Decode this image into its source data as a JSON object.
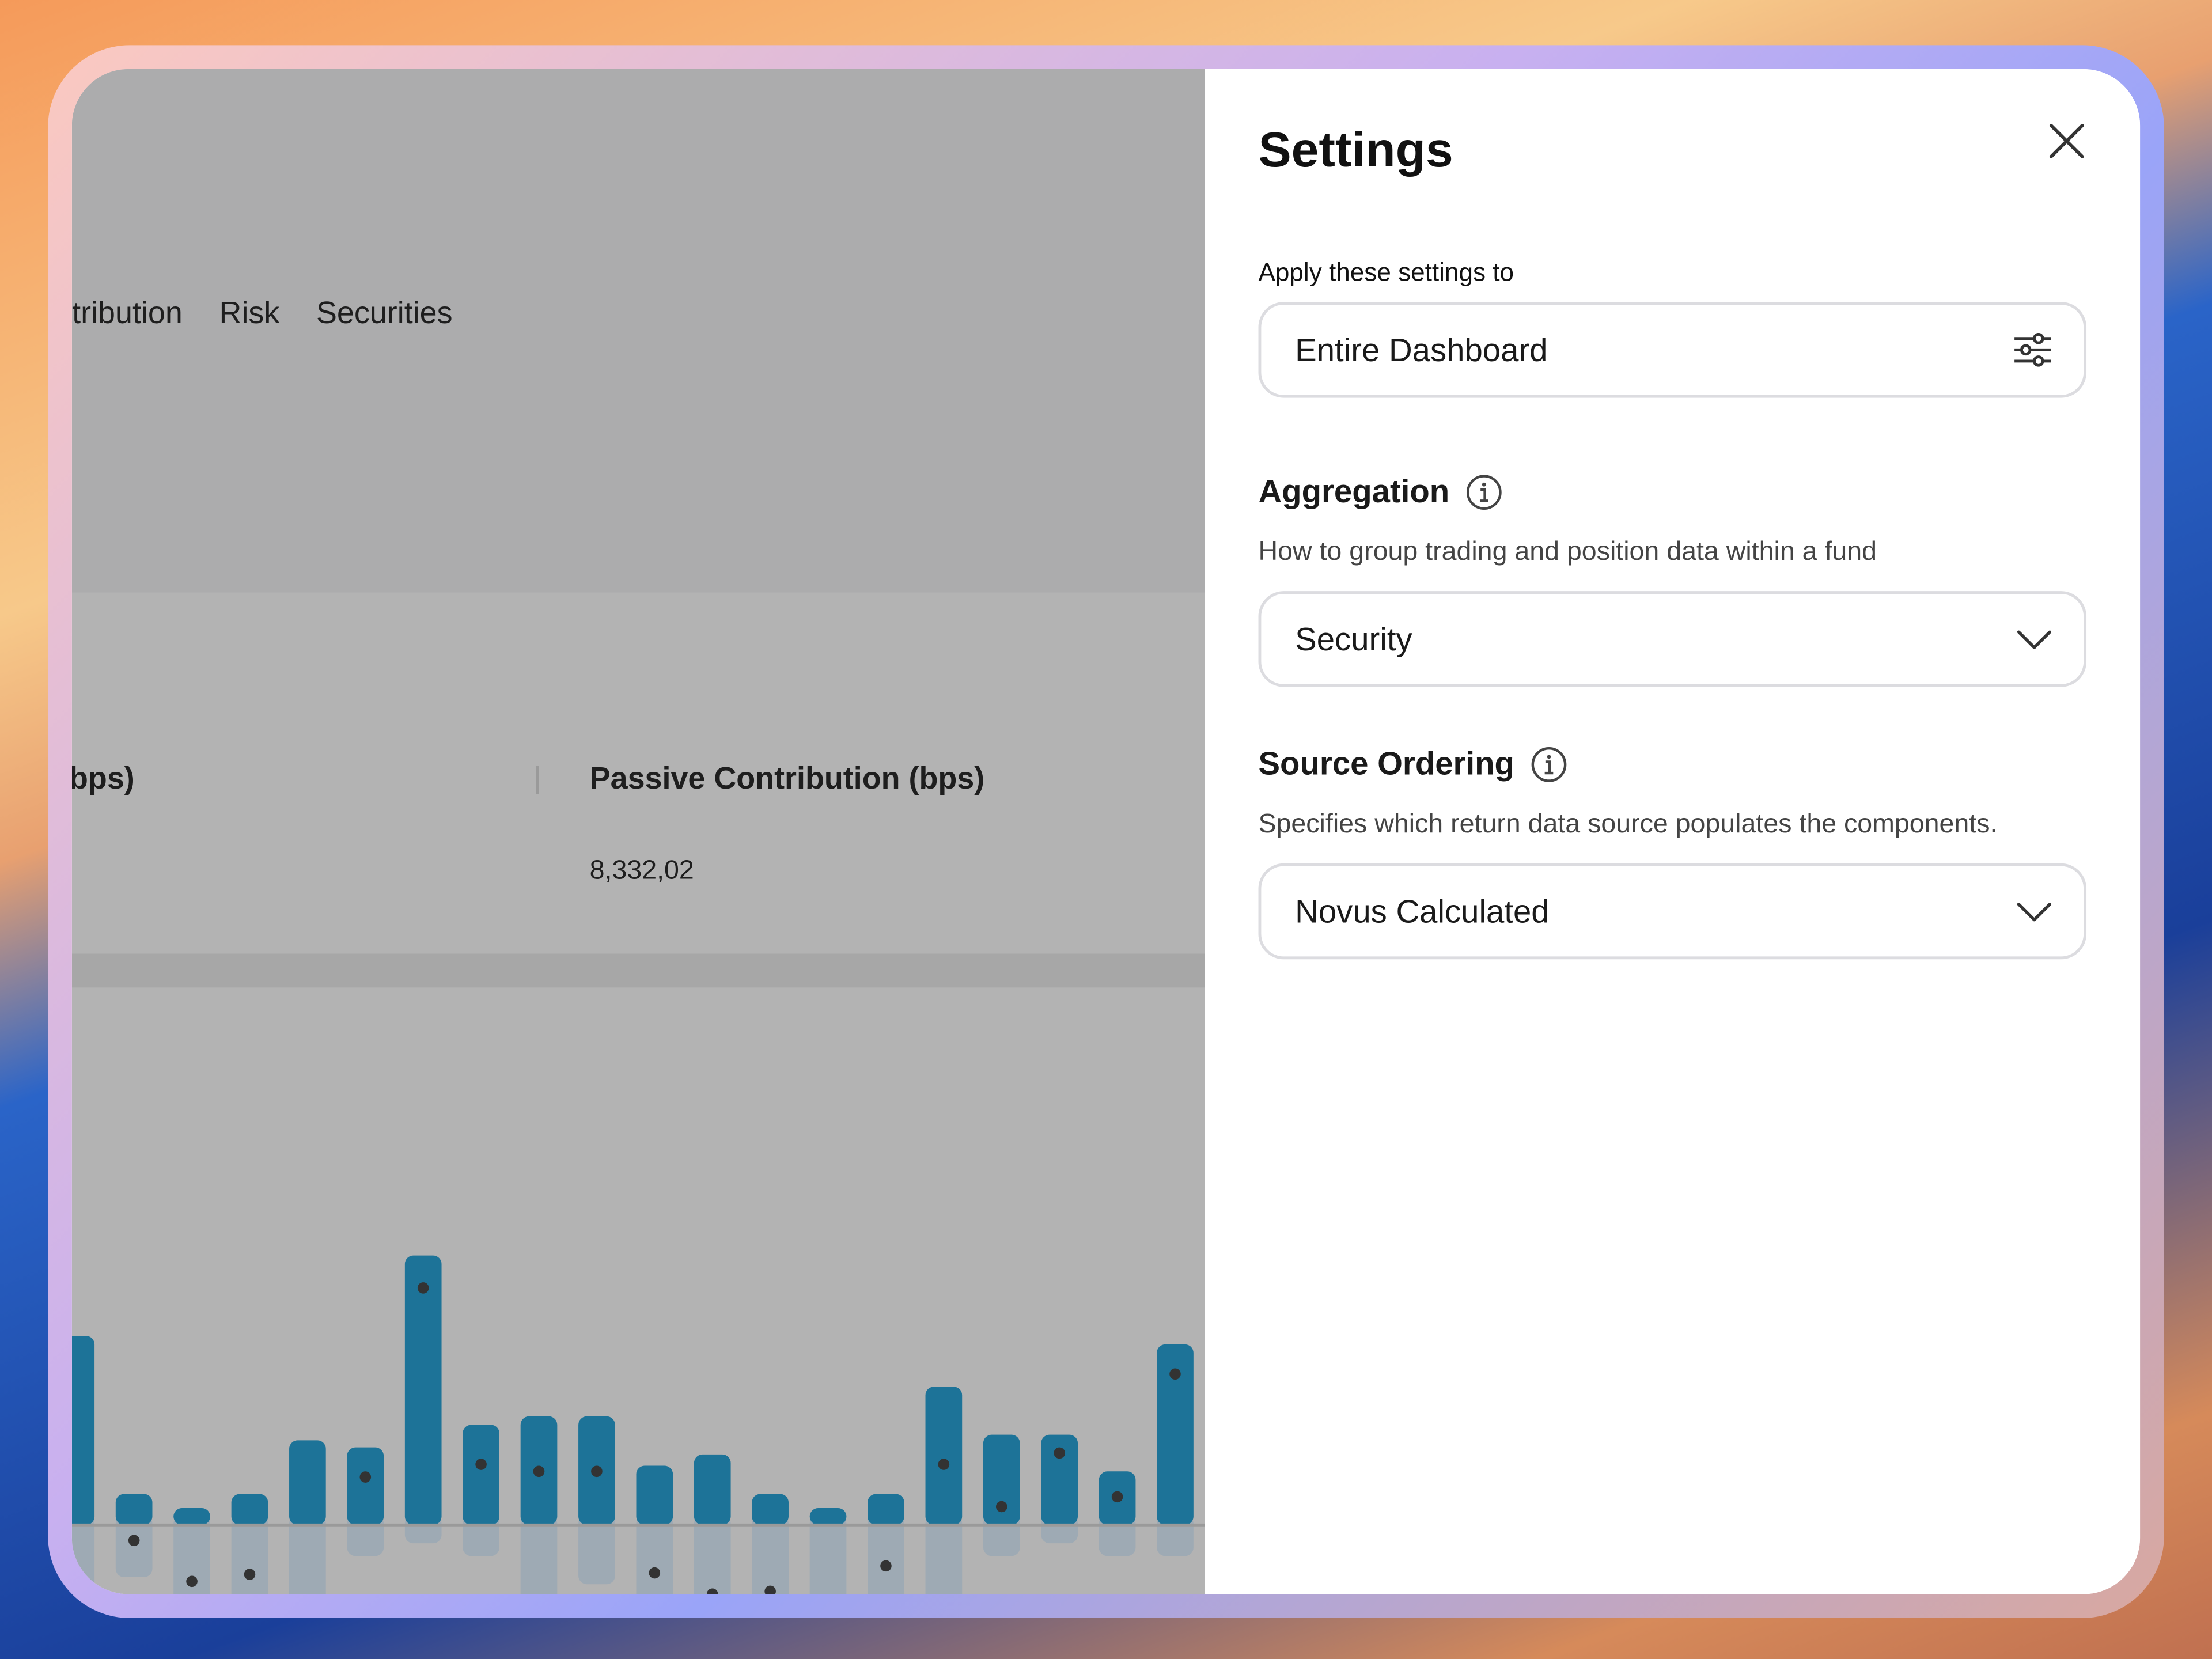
{
  "dashboard": {
    "nav": [
      "ttribution",
      "Risk",
      "Securities"
    ],
    "metric_left_header": "bps)",
    "metric_right_header": "Passive Contribution (bps)",
    "metric_right_value": "8,332,02"
  },
  "chart_data": {
    "type": "bar",
    "note_colors": {
      "positive_bar": "#1d7398",
      "negative_bar": "#9eaab4",
      "marker": "#333333"
    },
    "positive": [
      13.3,
      2.1,
      1.1,
      2.1,
      5.9,
      5.4,
      19,
      7,
      7.6,
      7.6,
      4.1,
      4.9,
      2.1,
      1.1,
      2.1,
      9.7,
      6.3,
      6.3,
      3.7,
      12.7
    ],
    "negative": [
      -6,
      -3.8,
      -6,
      -6,
      -6,
      -2.3,
      -1.4,
      -2.3,
      -6,
      -4.3,
      -6,
      -6,
      -6,
      -6,
      -6,
      -6,
      -2.3,
      -1.4,
      -2.3,
      -2.3
    ],
    "markers": [
      null,
      -1.2,
      -4.1,
      -3.6,
      null,
      3.3,
      16.7,
      4.2,
      3.7,
      3.7,
      -3.5,
      -5,
      -4.8,
      null,
      -3,
      4.2,
      1.2,
      5,
      1.9,
      10.6
    ]
  },
  "settings": {
    "title": "Settings",
    "apply_label": "Apply these settings to",
    "apply_value": "Entire Dashboard",
    "aggregation": {
      "title": "Aggregation",
      "description": "How to group trading and position data within a fund",
      "value": "Security"
    },
    "source_ordering": {
      "title": "Source Ordering",
      "description": "Specifies which return data source populates the components.",
      "value": "Novus Calculated"
    }
  }
}
